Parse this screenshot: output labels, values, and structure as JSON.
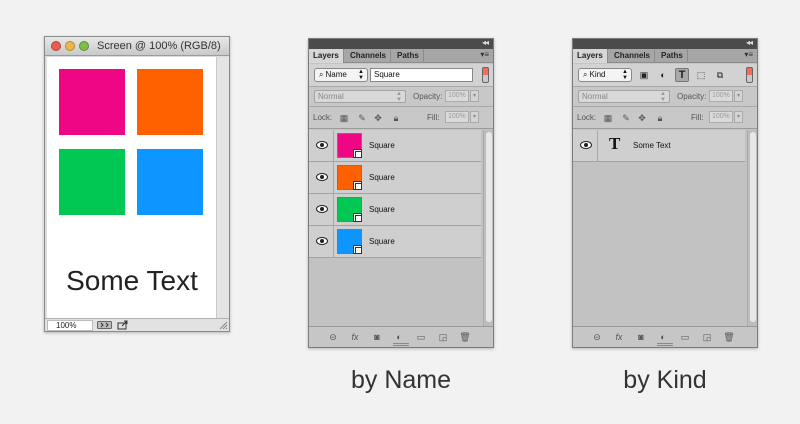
{
  "canvas_window": {
    "title": "Screen @ 100% (RGB/8)",
    "squares": [
      {
        "color": "#ee0685"
      },
      {
        "color": "#ff6000"
      },
      {
        "color": "#00c853"
      },
      {
        "color": "#0d96ff"
      }
    ],
    "text": "Some Text",
    "zoom": "100%"
  },
  "panel_tabs": [
    "Layers",
    "Channels",
    "Paths"
  ],
  "blend": {
    "mode": "Normal",
    "opacity_label": "Opacity:",
    "opacity_value": "100%",
    "lock_label": "Lock:",
    "fill_label": "Fill:",
    "fill_value": "100%"
  },
  "by_name": {
    "filter_type": "Name",
    "filter_value": "Square",
    "layers": [
      {
        "name": "Square",
        "color": "#ee0685"
      },
      {
        "name": "Square",
        "color": "#ff6000"
      },
      {
        "name": "Square",
        "color": "#00c853"
      },
      {
        "name": "Square",
        "color": "#0d96ff"
      }
    ],
    "caption": "by Name"
  },
  "by_kind": {
    "filter_type": "Kind",
    "kind_icons": [
      "pixel-filter-icon",
      "adjustment-filter-icon",
      "type-filter-icon",
      "shape-filter-icon",
      "smart-object-filter-icon"
    ],
    "active_kind": "type-filter-icon",
    "layers": [
      {
        "name": "Some Text",
        "icon": "text-layer-icon"
      }
    ],
    "caption": "by Kind"
  }
}
